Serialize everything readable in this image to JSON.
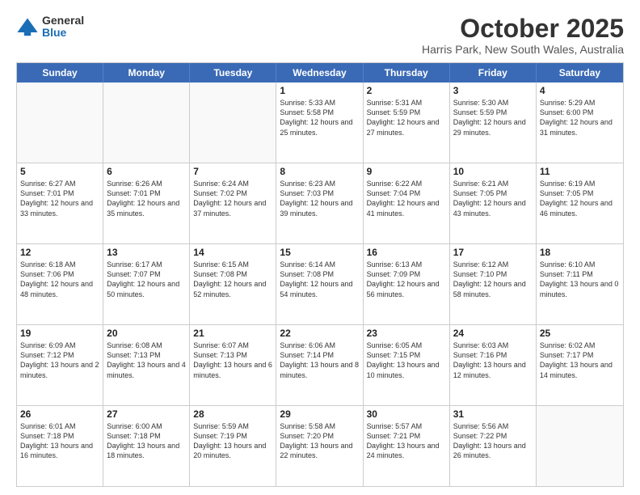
{
  "header": {
    "logo": {
      "general": "General",
      "blue": "Blue"
    },
    "title": "October 2025",
    "location": "Harris Park, New South Wales, Australia"
  },
  "days_of_week": [
    "Sunday",
    "Monday",
    "Tuesday",
    "Wednesday",
    "Thursday",
    "Friday",
    "Saturday"
  ],
  "weeks": [
    [
      {
        "day": "",
        "empty": true
      },
      {
        "day": "",
        "empty": true
      },
      {
        "day": "",
        "empty": true
      },
      {
        "day": "1",
        "rise": "Sunrise: 5:33 AM",
        "set": "Sunset: 5:58 PM",
        "daylight": "Daylight: 12 hours and 25 minutes."
      },
      {
        "day": "2",
        "rise": "Sunrise: 5:31 AM",
        "set": "Sunset: 5:59 PM",
        "daylight": "Daylight: 12 hours and 27 minutes."
      },
      {
        "day": "3",
        "rise": "Sunrise: 5:30 AM",
        "set": "Sunset: 5:59 PM",
        "daylight": "Daylight: 12 hours and 29 minutes."
      },
      {
        "day": "4",
        "rise": "Sunrise: 5:29 AM",
        "set": "Sunset: 6:00 PM",
        "daylight": "Daylight: 12 hours and 31 minutes."
      }
    ],
    [
      {
        "day": "5",
        "rise": "Sunrise: 6:27 AM",
        "set": "Sunset: 7:01 PM",
        "daylight": "Daylight: 12 hours and 33 minutes."
      },
      {
        "day": "6",
        "rise": "Sunrise: 6:26 AM",
        "set": "Sunset: 7:01 PM",
        "daylight": "Daylight: 12 hours and 35 minutes."
      },
      {
        "day": "7",
        "rise": "Sunrise: 6:24 AM",
        "set": "Sunset: 7:02 PM",
        "daylight": "Daylight: 12 hours and 37 minutes."
      },
      {
        "day": "8",
        "rise": "Sunrise: 6:23 AM",
        "set": "Sunset: 7:03 PM",
        "daylight": "Daylight: 12 hours and 39 minutes."
      },
      {
        "day": "9",
        "rise": "Sunrise: 6:22 AM",
        "set": "Sunset: 7:04 PM",
        "daylight": "Daylight: 12 hours and 41 minutes."
      },
      {
        "day": "10",
        "rise": "Sunrise: 6:21 AM",
        "set": "Sunset: 7:05 PM",
        "daylight": "Daylight: 12 hours and 43 minutes."
      },
      {
        "day": "11",
        "rise": "Sunrise: 6:19 AM",
        "set": "Sunset: 7:05 PM",
        "daylight": "Daylight: 12 hours and 46 minutes."
      }
    ],
    [
      {
        "day": "12",
        "rise": "Sunrise: 6:18 AM",
        "set": "Sunset: 7:06 PM",
        "daylight": "Daylight: 12 hours and 48 minutes."
      },
      {
        "day": "13",
        "rise": "Sunrise: 6:17 AM",
        "set": "Sunset: 7:07 PM",
        "daylight": "Daylight: 12 hours and 50 minutes."
      },
      {
        "day": "14",
        "rise": "Sunrise: 6:15 AM",
        "set": "Sunset: 7:08 PM",
        "daylight": "Daylight: 12 hours and 52 minutes."
      },
      {
        "day": "15",
        "rise": "Sunrise: 6:14 AM",
        "set": "Sunset: 7:08 PM",
        "daylight": "Daylight: 12 hours and 54 minutes."
      },
      {
        "day": "16",
        "rise": "Sunrise: 6:13 AM",
        "set": "Sunset: 7:09 PM",
        "daylight": "Daylight: 12 hours and 56 minutes."
      },
      {
        "day": "17",
        "rise": "Sunrise: 6:12 AM",
        "set": "Sunset: 7:10 PM",
        "daylight": "Daylight: 12 hours and 58 minutes."
      },
      {
        "day": "18",
        "rise": "Sunrise: 6:10 AM",
        "set": "Sunset: 7:11 PM",
        "daylight": "Daylight: 13 hours and 0 minutes."
      }
    ],
    [
      {
        "day": "19",
        "rise": "Sunrise: 6:09 AM",
        "set": "Sunset: 7:12 PM",
        "daylight": "Daylight: 13 hours and 2 minutes."
      },
      {
        "day": "20",
        "rise": "Sunrise: 6:08 AM",
        "set": "Sunset: 7:13 PM",
        "daylight": "Daylight: 13 hours and 4 minutes."
      },
      {
        "day": "21",
        "rise": "Sunrise: 6:07 AM",
        "set": "Sunset: 7:13 PM",
        "daylight": "Daylight: 13 hours and 6 minutes."
      },
      {
        "day": "22",
        "rise": "Sunrise: 6:06 AM",
        "set": "Sunset: 7:14 PM",
        "daylight": "Daylight: 13 hours and 8 minutes."
      },
      {
        "day": "23",
        "rise": "Sunrise: 6:05 AM",
        "set": "Sunset: 7:15 PM",
        "daylight": "Daylight: 13 hours and 10 minutes."
      },
      {
        "day": "24",
        "rise": "Sunrise: 6:03 AM",
        "set": "Sunset: 7:16 PM",
        "daylight": "Daylight: 13 hours and 12 minutes."
      },
      {
        "day": "25",
        "rise": "Sunrise: 6:02 AM",
        "set": "Sunset: 7:17 PM",
        "daylight": "Daylight: 13 hours and 14 minutes."
      }
    ],
    [
      {
        "day": "26",
        "rise": "Sunrise: 6:01 AM",
        "set": "Sunset: 7:18 PM",
        "daylight": "Daylight: 13 hours and 16 minutes."
      },
      {
        "day": "27",
        "rise": "Sunrise: 6:00 AM",
        "set": "Sunset: 7:18 PM",
        "daylight": "Daylight: 13 hours and 18 minutes."
      },
      {
        "day": "28",
        "rise": "Sunrise: 5:59 AM",
        "set": "Sunset: 7:19 PM",
        "daylight": "Daylight: 13 hours and 20 minutes."
      },
      {
        "day": "29",
        "rise": "Sunrise: 5:58 AM",
        "set": "Sunset: 7:20 PM",
        "daylight": "Daylight: 13 hours and 22 minutes."
      },
      {
        "day": "30",
        "rise": "Sunrise: 5:57 AM",
        "set": "Sunset: 7:21 PM",
        "daylight": "Daylight: 13 hours and 24 minutes."
      },
      {
        "day": "31",
        "rise": "Sunrise: 5:56 AM",
        "set": "Sunset: 7:22 PM",
        "daylight": "Daylight: 13 hours and 26 minutes."
      },
      {
        "day": "",
        "empty": true
      }
    ]
  ]
}
